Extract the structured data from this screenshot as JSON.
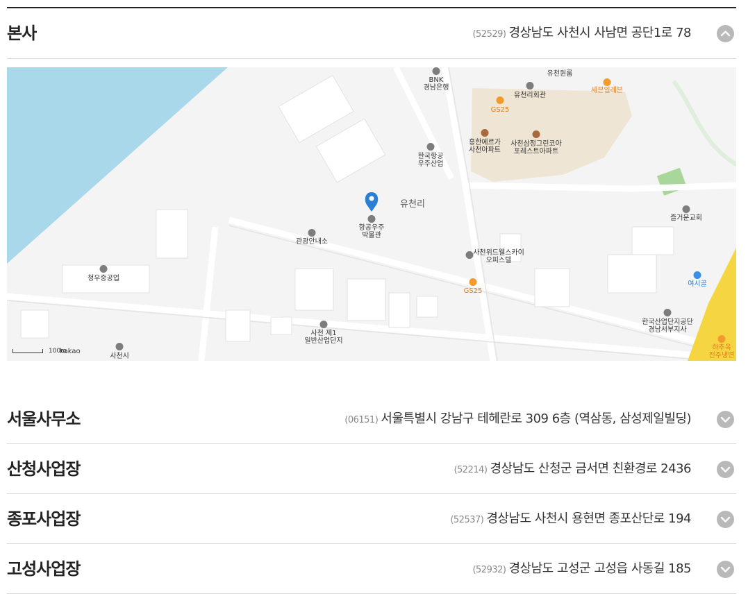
{
  "offices": [
    {
      "name": "본사",
      "zip": "(52529)",
      "address": "경상남도 사천시 사남면 공단1로 78",
      "expanded": true
    },
    {
      "name": "서울사무소",
      "zip": "(06151)",
      "address": "서울특별시 강남구 테헤란로 309 6층 (역삼동, 삼성제일빌딩)",
      "expanded": false
    },
    {
      "name": "산청사업장",
      "zip": "(52214)",
      "address": "경상남도 산청군 금서면 친환경로 2436",
      "expanded": false
    },
    {
      "name": "종포사업장",
      "zip": "(52537)",
      "address": "경상남도 사천시 용현면 종포산단로 194",
      "expanded": false
    },
    {
      "name": "고성사업장",
      "zip": "(52932)",
      "address": "경상남도 고성군 고성읍 사동길 185",
      "expanded": false
    }
  ],
  "map": {
    "scale": "100m",
    "brand": "kakao",
    "labels": {
      "bnk1": "BNK",
      "bnk2": "경남은행",
      "yuchon_won": "유천원룸",
      "yuchon_hall": "유천리회관",
      "sebun": "세븐일레븐",
      "gs25_top": "GS25",
      "heung1": "흥한에르가",
      "heung2": "사천아파트",
      "samjeong1": "사천삼정그린코아",
      "samjeong2": "포레스트아파트",
      "kai1": "한국항공",
      "kai2": "우주산업",
      "yuchon": "유천리",
      "museum1": "항공우주",
      "museum2": "박물관",
      "tour": "관광안내소",
      "skyview1": "사천위드웰스카이",
      "skyview2": "오피스텔",
      "gs25_mid": "GS25",
      "jeulgeo": "즐거운교회",
      "cheongwoo": "청우중공업",
      "yeosi": "여시골",
      "complex1": "사천 제1",
      "complex2": "일반산업단지",
      "kicox1": "한국산업단지공단",
      "kicox2": "경남서부지사",
      "hachu1": "하추옥",
      "hachu2": "진주냉면",
      "sacheon": "사천시"
    },
    "colors": {
      "sea": "#a8d8ea",
      "land": "#f4f4f4",
      "block": "#ffffff",
      "apt": "#efe5d4",
      "road_yellow": "#f5d542",
      "marker": "#2a7fd4"
    }
  }
}
